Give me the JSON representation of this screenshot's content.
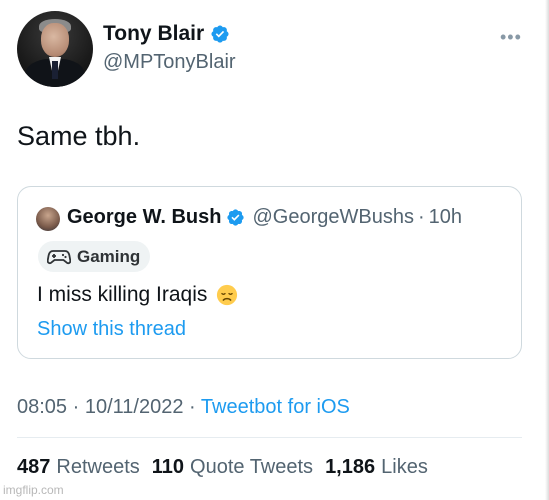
{
  "author": {
    "name": "Tony Blair",
    "handle": "@MPTonyBlair"
  },
  "tweet": {
    "text": "Same tbh."
  },
  "more_icon": "more-dots-icon",
  "quote": {
    "author_name": "George W. Bush",
    "author_handle": "@GeorgeWBushs",
    "separator": "·",
    "time": "10h",
    "badge_label": "Gaming",
    "badge_icon": "gamepad-icon",
    "text": "I miss killing Iraqis",
    "emoji": "disappointed-face-emoji",
    "show_thread": "Show this thread"
  },
  "meta": {
    "time": "08:05",
    "separator": "·",
    "date": "10/11/2022",
    "source": "Tweetbot for iOS"
  },
  "stats": {
    "retweets_count": "487",
    "retweets_label": "Retweets",
    "quote_count": "110",
    "quote_label": "Quote Tweets",
    "likes_count": "1,186",
    "likes_label": "Likes"
  },
  "watermark": "imgflip.com",
  "colors": {
    "link": "#1d9bf0",
    "secondary": "#536471",
    "verified": "#1d9bf0"
  }
}
